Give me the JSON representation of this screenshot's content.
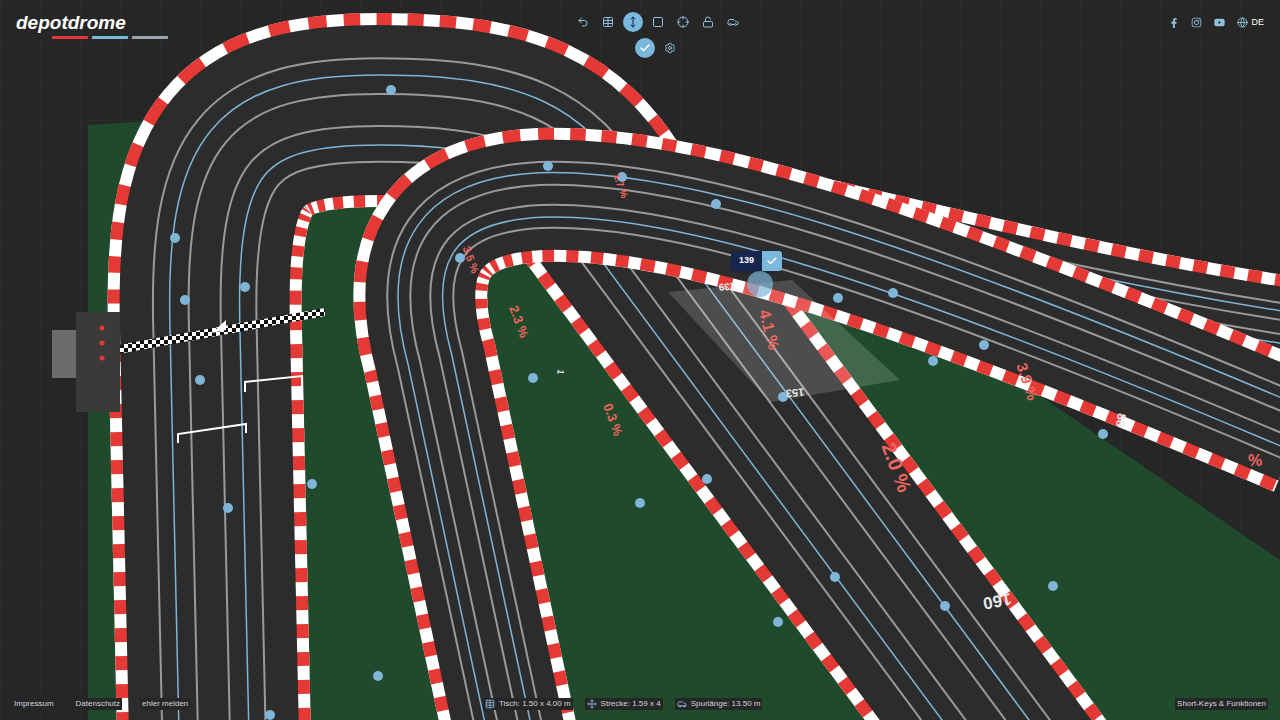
{
  "logo": "depotdrome",
  "toolbar": [
    {
      "selected": false
    },
    {
      "selected": false
    },
    {
      "selected": true
    },
    {
      "selected": false
    },
    {
      "selected": false
    },
    {
      "selected": false
    },
    {
      "selected": false
    }
  ],
  "subtoolbar": [
    {
      "selected": true
    },
    {
      "selected": false
    }
  ],
  "language": "DE",
  "tooltip": {
    "value": "139"
  },
  "track_labels": [
    {
      "text": "139",
      "color": "#e6e8ea"
    },
    {
      "text": "4.1 %",
      "color": "#f0675f"
    },
    {
      "text": "153",
      "color": "#e6e8ea"
    },
    {
      "text": "2.0 %",
      "color": "#f0675f"
    },
    {
      "text": "160",
      "color": "#e6e8ea"
    },
    {
      "text": "0.3 %",
      "color": "#f0675f"
    },
    {
      "text": "2.3 %",
      "color": "#f0675f"
    },
    {
      "text": "3.5 %",
      "color": "#f0675f"
    },
    {
      "text": "1",
      "color": "#e6e8ea"
    },
    {
      "text": "3.9 %",
      "color": "#f0675f"
    },
    {
      "text": "88",
      "color": "#e6e8ea"
    },
    {
      "text": "%",
      "color": "#f0675f"
    },
    {
      "text": "1.7 %",
      "color": "#f0675f"
    }
  ],
  "footer": {
    "links": [
      "Impressum",
      "Datenschutz",
      "ehler melden"
    ],
    "stats": [
      "Tisch: 1.50 x 4.00 m",
      "Strecke: 1.59 x 4",
      "Spurlänge: 13.50 m"
    ],
    "help": "Short-Keys & Funktionen"
  }
}
